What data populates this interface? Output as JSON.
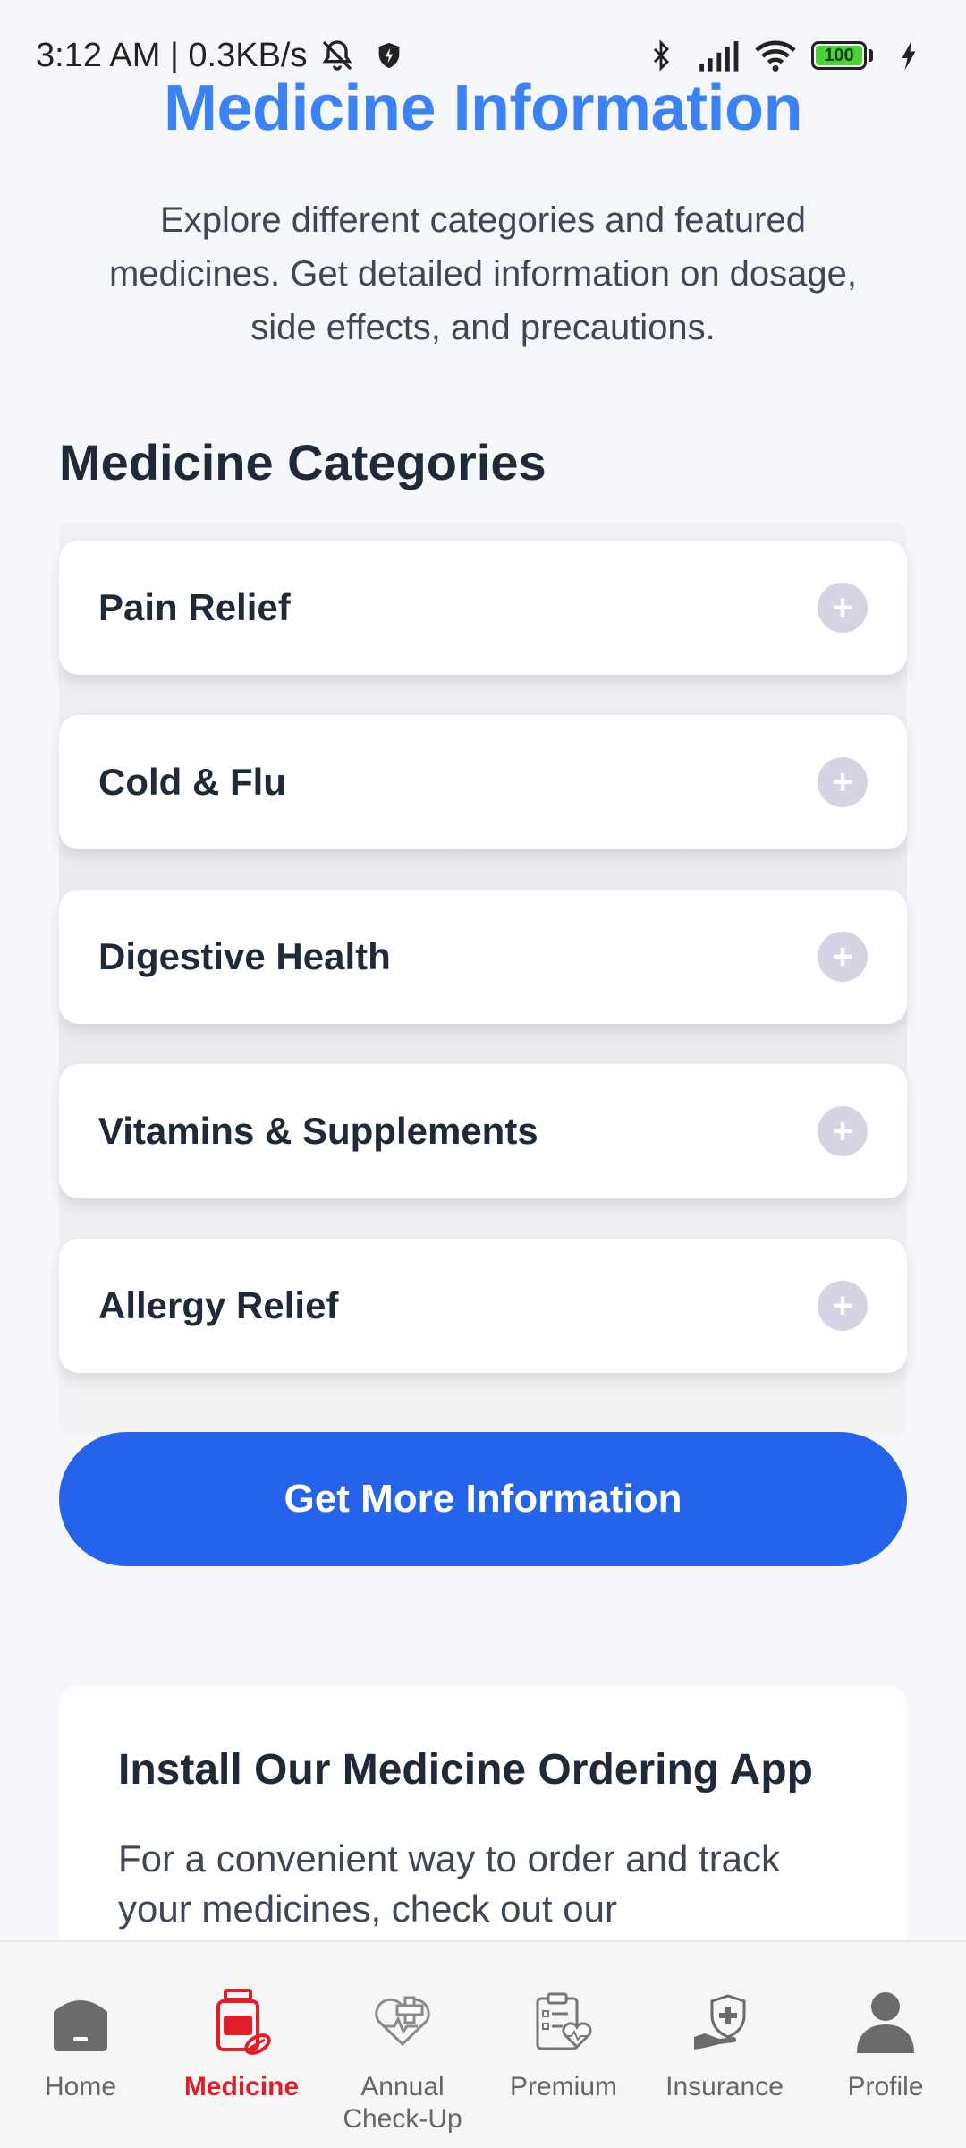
{
  "status_bar": {
    "time_speed": "3:12 AM | 0.3KB/s",
    "battery_level": "100",
    "icons": [
      "mute-alarm-icon",
      "shield-icon",
      "bluetooth-icon",
      "signal-icon",
      "wifi-icon",
      "battery-icon",
      "charging-icon"
    ]
  },
  "header": {
    "title": "Medicine Information",
    "intro": "Explore different categories and featured medicines. Get detailed information on dosage, side effects, and precautions."
  },
  "categories": {
    "heading": "Medicine Categories",
    "items": [
      {
        "label": "Pain Relief"
      },
      {
        "label": "Cold & Flu"
      },
      {
        "label": "Digestive Health"
      },
      {
        "label": "Vitamins & Supplements"
      },
      {
        "label": "Allergy Relief"
      }
    ],
    "expand_symbol": "+"
  },
  "cta": {
    "label": "Get More Information"
  },
  "install_card": {
    "title": "Install Our Medicine Ordering App",
    "text": "For a convenient way to order and track your medicines, check out our"
  },
  "bottom_nav": {
    "items": [
      {
        "label": "Home",
        "icon": "home-icon",
        "active": false
      },
      {
        "label": "Medicine",
        "icon": "medicine-bottle-icon",
        "active": true
      },
      {
        "label": "Annual Check-Up",
        "icon": "heart-checkup-icon",
        "active": false
      },
      {
        "label": "Premium",
        "icon": "clipboard-heart-icon",
        "active": false
      },
      {
        "label": "Insurance",
        "icon": "hand-shield-icon",
        "active": false
      },
      {
        "label": "Profile",
        "icon": "person-icon",
        "active": false
      }
    ]
  },
  "colors": {
    "accent_title": "#3b82f6",
    "cta": "#2563eb",
    "active_nav": "#e11d2a"
  }
}
